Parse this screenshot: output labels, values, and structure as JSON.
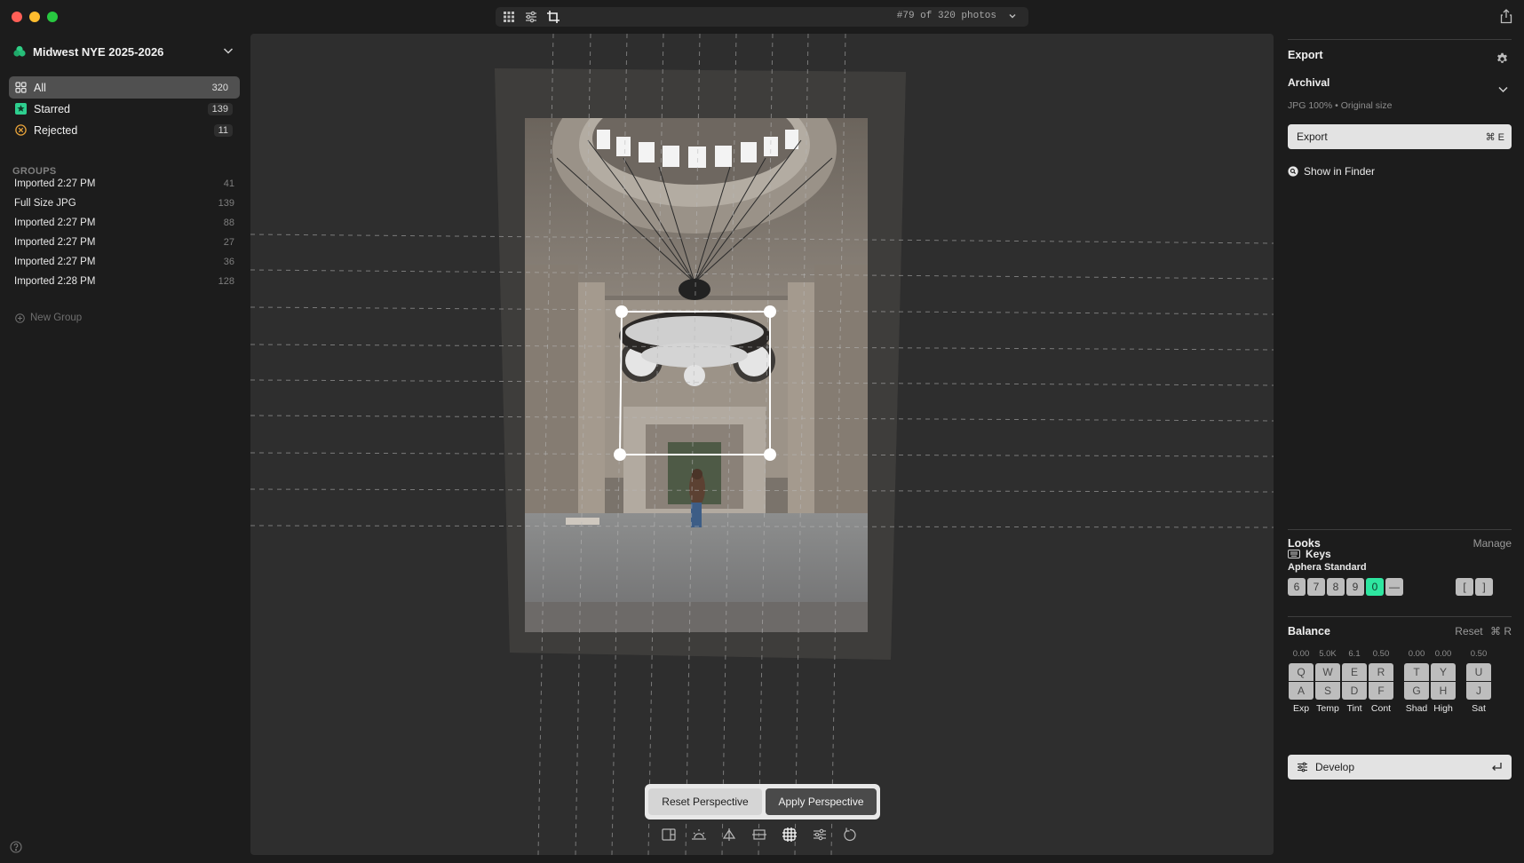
{
  "toolbar": {
    "counter": "#79 of 320 photos",
    "icons": [
      "grid-icon",
      "sliders-icon",
      "crop-icon"
    ]
  },
  "sidebar": {
    "library_title": "Midwest NYE 2025-2026",
    "nav": [
      {
        "label": "All",
        "count": "320",
        "icon": "grid-icon",
        "active": true
      },
      {
        "label": "Starred",
        "count": "139",
        "icon": "star-icon",
        "color": "#2ecf8f"
      },
      {
        "label": "Rejected",
        "count": "11",
        "icon": "reject-icon",
        "color": "#e8a33a"
      }
    ],
    "groups_heading": "GROUPS",
    "groups": [
      {
        "label": "Imported 2:27 PM",
        "count": "41"
      },
      {
        "label": "Full Size JPG",
        "count": "139"
      },
      {
        "label": "Imported 2:27 PM",
        "count": "88"
      },
      {
        "label": "Imported 2:27 PM",
        "count": "27"
      },
      {
        "label": "Imported 2:27 PM",
        "count": "36"
      },
      {
        "label": "Imported 2:28 PM",
        "count": "128"
      }
    ],
    "new_group": "New Group"
  },
  "canvas": {
    "reset_label": "Reset Perspective",
    "apply_label": "Apply Perspective",
    "tools": [
      "layout-icon",
      "exposure-icon",
      "balance-icon",
      "horizon-icon",
      "perspective-icon",
      "adjust-icon",
      "rotate-icon"
    ]
  },
  "right_panel": {
    "export_title": "Export",
    "preset_name": "Archival",
    "preset_detail": "JPG 100% • Original size",
    "export_button": "Export",
    "export_shortcut": "⌘ E",
    "show_in_finder": "Show in Finder",
    "keys_title": "Keys",
    "looks_title": "Looks",
    "manage_label": "Manage",
    "look_name": "Aphera Standard",
    "look_keys": [
      "6",
      "7",
      "8",
      "9",
      "0",
      "—"
    ],
    "look_active": "0",
    "bracket_keys": [
      "[",
      "]"
    ],
    "balance_title": "Balance",
    "reset_label": "Reset",
    "reset_shortcut": "⌘ R",
    "balance": [
      {
        "label": "Exp",
        "value": "0.00",
        "up": "Q",
        "down": "A"
      },
      {
        "label": "Temp",
        "value": "5.0K",
        "up": "W",
        "down": "S"
      },
      {
        "label": "Tint",
        "value": "6.1",
        "up": "E",
        "down": "D"
      },
      {
        "label": "Cont",
        "value": "0.50",
        "up": "R",
        "down": "F"
      },
      {
        "label": "Shad",
        "value": "0.00",
        "up": "T",
        "down": "G"
      },
      {
        "label": "High",
        "value": "0.00",
        "up": "Y",
        "down": "H"
      },
      {
        "label": "Sat",
        "value": "0.50",
        "up": "U",
        "down": "J"
      }
    ],
    "develop_label": "Develop"
  },
  "colors": {
    "accent_green": "#2ee6a0",
    "canvas_bg": "#2e2e2e",
    "sidebar_bg": "#1c1c1c"
  }
}
